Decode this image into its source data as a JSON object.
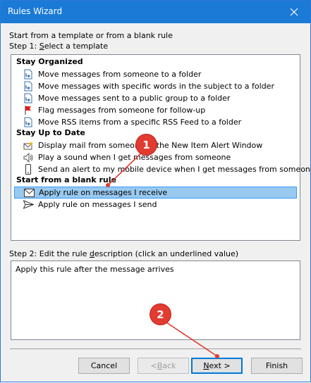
{
  "window": {
    "title": "Rules Wizard",
    "close_glyph": "✕"
  },
  "intro": "Start from a template or from a blank rule",
  "step1": {
    "prefix": "Step 1: ",
    "underlined": "S",
    "rest": "elect a template"
  },
  "groups": [
    {
      "header": "Stay Organized",
      "items": [
        {
          "label": "Move messages from someone to a folder",
          "icon": "move-to-folder-icon"
        },
        {
          "label": "Move messages with specific words in the subject to a folder",
          "icon": "move-to-folder-icon"
        },
        {
          "label": "Move messages sent to a public group to a folder",
          "icon": "move-to-folder-icon"
        },
        {
          "label": "Flag messages from someone for follow-up",
          "icon": "red-flag-icon"
        },
        {
          "label": "Move RSS items from a specific RSS Feed to a folder",
          "icon": "move-to-folder-icon"
        }
      ]
    },
    {
      "header": "Stay Up to Date",
      "items": [
        {
          "label": "Display mail from someone in the New Item Alert Window",
          "icon": "alert-envelope-icon"
        },
        {
          "label": "Play a sound when I get messages from someone",
          "icon": "speaker-icon"
        },
        {
          "label": "Send an alert to my mobile device when I get messages from someone",
          "icon": "mobile-phone-icon"
        }
      ]
    },
    {
      "header": "Start from a blank rule",
      "items": [
        {
          "label": "Apply rule on messages I receive",
          "icon": "envelope-icon",
          "selected": true
        },
        {
          "label": "Apply rule on messages I send",
          "icon": "paper-plane-icon"
        }
      ]
    }
  ],
  "step2": {
    "prefix": "Step 2: Edit the rule ",
    "underlined": "d",
    "rest": "escription (click an underlined value)"
  },
  "description_text": "Apply this rule after the message arrives",
  "buttons": {
    "cancel": "Cancel",
    "back_prefix": "< ",
    "back_u": "B",
    "back_rest": "ack",
    "next_u": "N",
    "next_rest": "ext >",
    "finish": "Finish"
  },
  "callouts": {
    "one": "1",
    "two": "2"
  },
  "colors": {
    "titlebar": "#1a7ad6",
    "selection": "#99c9ef",
    "callout": "#e23b30"
  }
}
